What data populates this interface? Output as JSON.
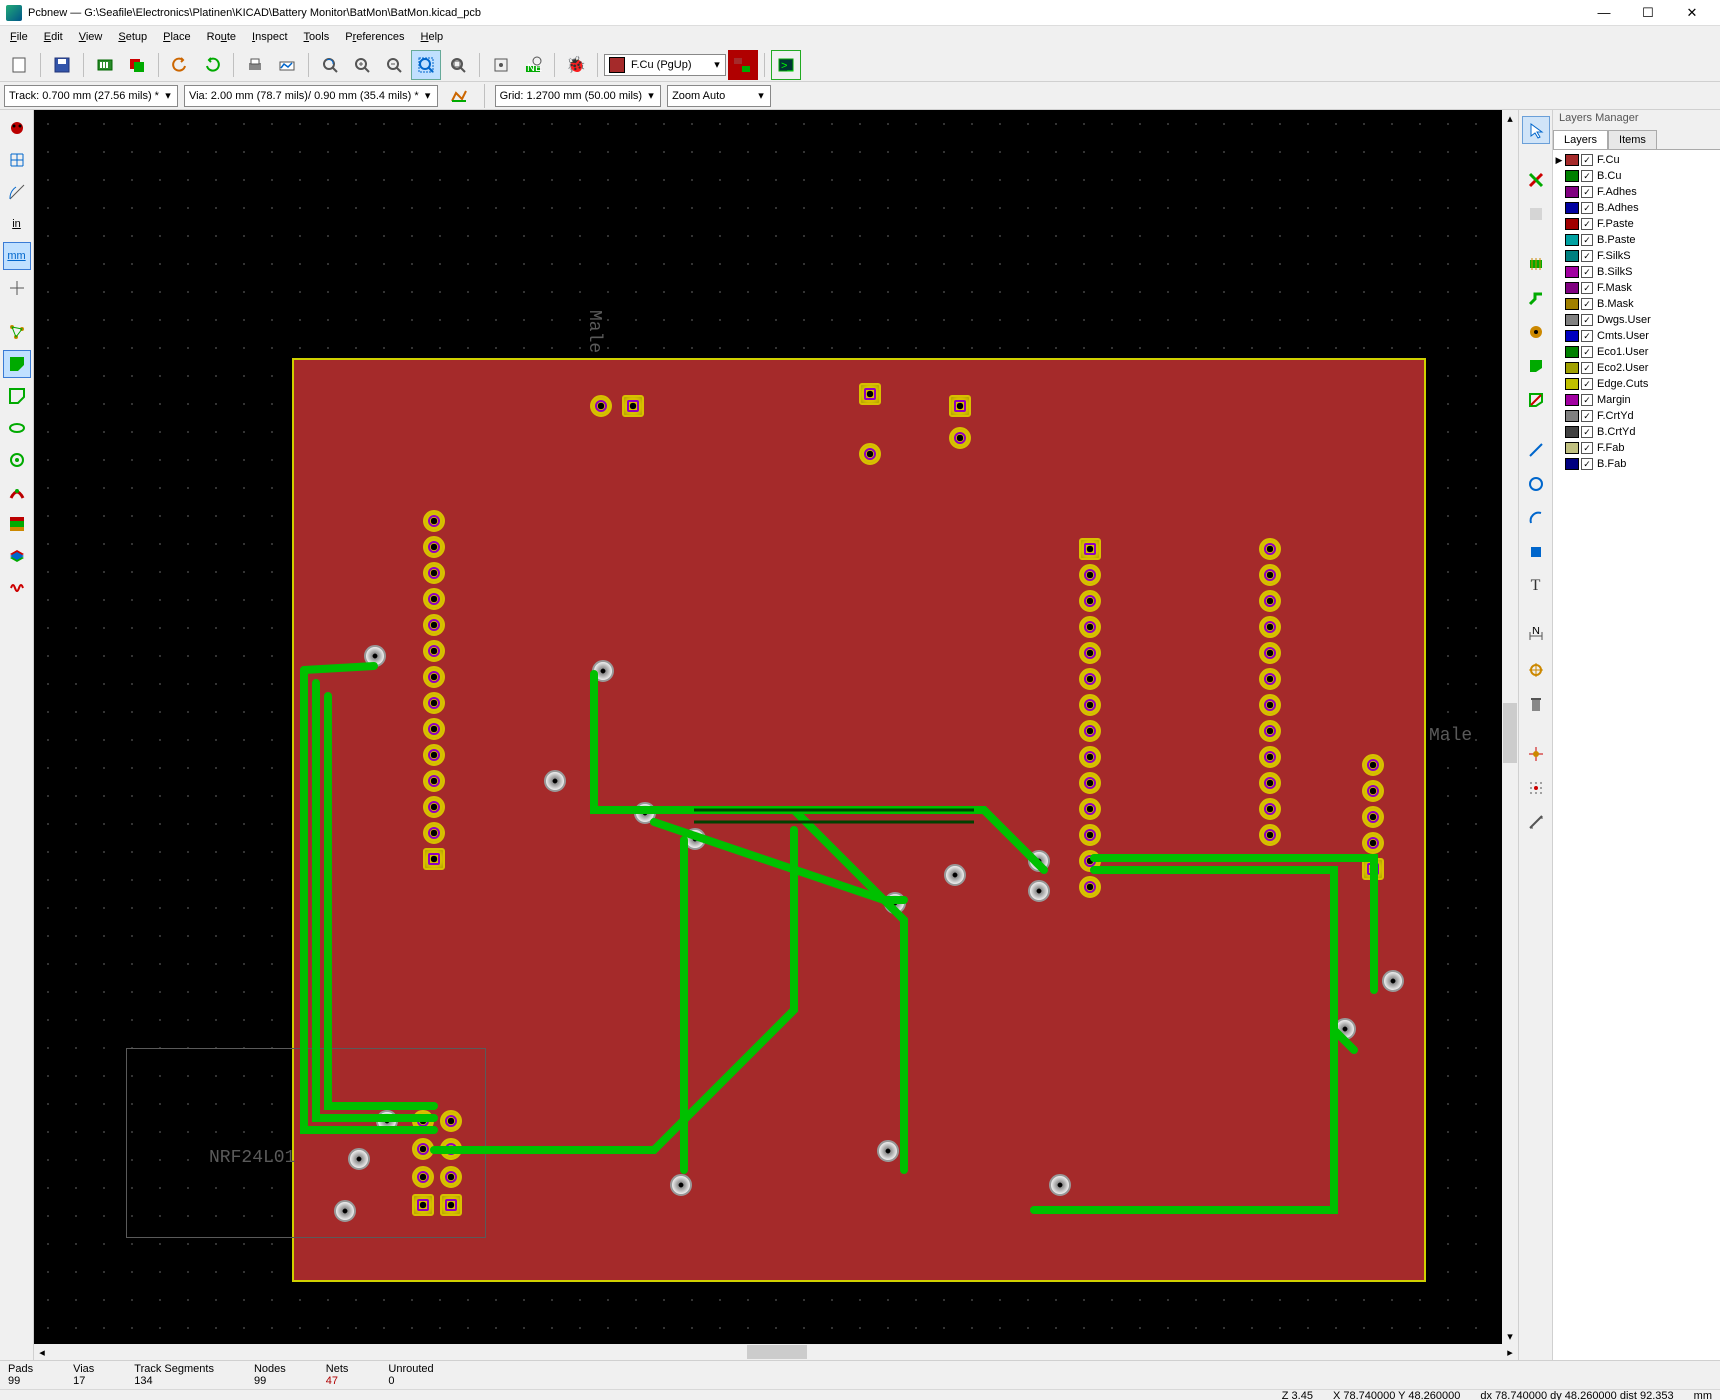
{
  "window": {
    "title": "Pcbnew — G:\\Seafile\\Electronics\\Platinen\\KICAD\\Battery Monitor\\BatMon\\BatMon.kicad_pcb"
  },
  "menu": {
    "file": "File",
    "edit": "Edit",
    "view": "View",
    "setup": "Setup",
    "place": "Place",
    "route": "Route",
    "inspect": "Inspect",
    "tools": "Tools",
    "preferences": "Preferences",
    "help": "Help"
  },
  "toolbar1": {
    "layer_name": "F.Cu (PgUp)"
  },
  "toolbar2": {
    "track": "Track: 0.700 mm (27.56 mils) *",
    "via": "Via: 2.00 mm (78.7 mils)/ 0.90 mm (35.4 mils) *",
    "grid": "Grid: 1.2700 mm (50.00 mils)",
    "zoom": "Zoom Auto"
  },
  "left_icons": {
    "in": "in",
    "mm": "mm"
  },
  "canvas": {
    "silk_module": "NRF24L01",
    "silk_male": "Male",
    "silk_male2": "Male"
  },
  "layers_panel": {
    "title": "Layers Manager",
    "tab_layers": "Layers",
    "tab_items": "Items",
    "layers": [
      {
        "name": "F.Cu",
        "color": "#a52a2a"
      },
      {
        "name": "B.Cu",
        "color": "#008000"
      },
      {
        "name": "F.Adhes",
        "color": "#800080"
      },
      {
        "name": "B.Adhes",
        "color": "#0000a0"
      },
      {
        "name": "F.Paste",
        "color": "#a00000"
      },
      {
        "name": "B.Paste",
        "color": "#00a0a0"
      },
      {
        "name": "F.SilkS",
        "color": "#008080"
      },
      {
        "name": "B.SilkS",
        "color": "#a000a0"
      },
      {
        "name": "F.Mask",
        "color": "#800080"
      },
      {
        "name": "B.Mask",
        "color": "#a08000"
      },
      {
        "name": "Dwgs.User",
        "color": "#808080"
      },
      {
        "name": "Cmts.User",
        "color": "#0000c0"
      },
      {
        "name": "Eco1.User",
        "color": "#008000"
      },
      {
        "name": "Eco2.User",
        "color": "#a0a000"
      },
      {
        "name": "Edge.Cuts",
        "color": "#c0c000"
      },
      {
        "name": "Margin",
        "color": "#a000a0"
      },
      {
        "name": "F.CrtYd",
        "color": "#808080"
      },
      {
        "name": "B.CrtYd",
        "color": "#404040"
      },
      {
        "name": "F.Fab",
        "color": "#c0c080"
      },
      {
        "name": "B.Fab",
        "color": "#000080"
      }
    ]
  },
  "status": {
    "pads_h": "Pads",
    "pads_v": "99",
    "vias_h": "Vias",
    "vias_v": "17",
    "trk_h": "Track Segments",
    "trk_v": "134",
    "nodes_h": "Nodes",
    "nodes_v": "99",
    "nets_h": "Nets",
    "nets_v": "47",
    "unr_h": "Unrouted",
    "unr_v": "0",
    "z": "Z 3.45",
    "xy": "X 78.740000  Y 48.260000",
    "dxy": "dx 78.740000  dy 48.260000  dist 92.353",
    "unit": "mm"
  }
}
